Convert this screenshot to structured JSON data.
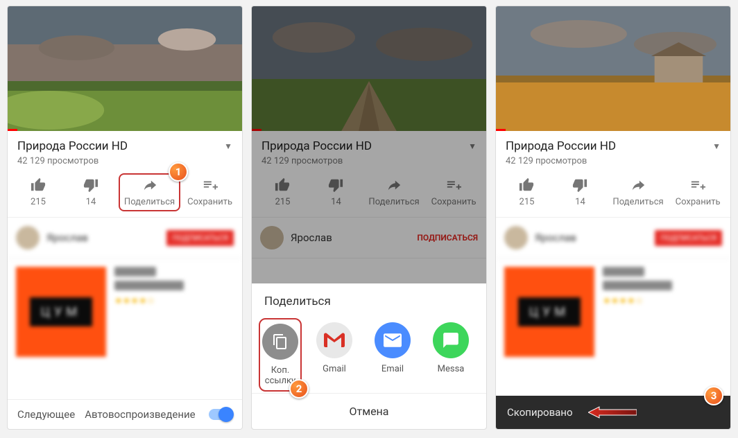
{
  "video": {
    "title": "Природа России HD",
    "views": "42 129 просмотров"
  },
  "actions": {
    "like": "215",
    "dislike": "14",
    "share": "Поделиться",
    "save": "Сохранить"
  },
  "channel": {
    "name": "Ярослав",
    "subscribe": "ПОДПИСАТЬСЯ"
  },
  "autoplay": {
    "next": "Следующее",
    "label": "Автовоспроизведение"
  },
  "share_sheet": {
    "title": "Поделиться",
    "copy": "Коп. ссылку",
    "gmail": "Gmail",
    "email": "Email",
    "message": "Messa",
    "cancel": "Отмена"
  },
  "toast": "Скопировано",
  "steps": {
    "s1": "1",
    "s2": "2",
    "s3": "3"
  }
}
